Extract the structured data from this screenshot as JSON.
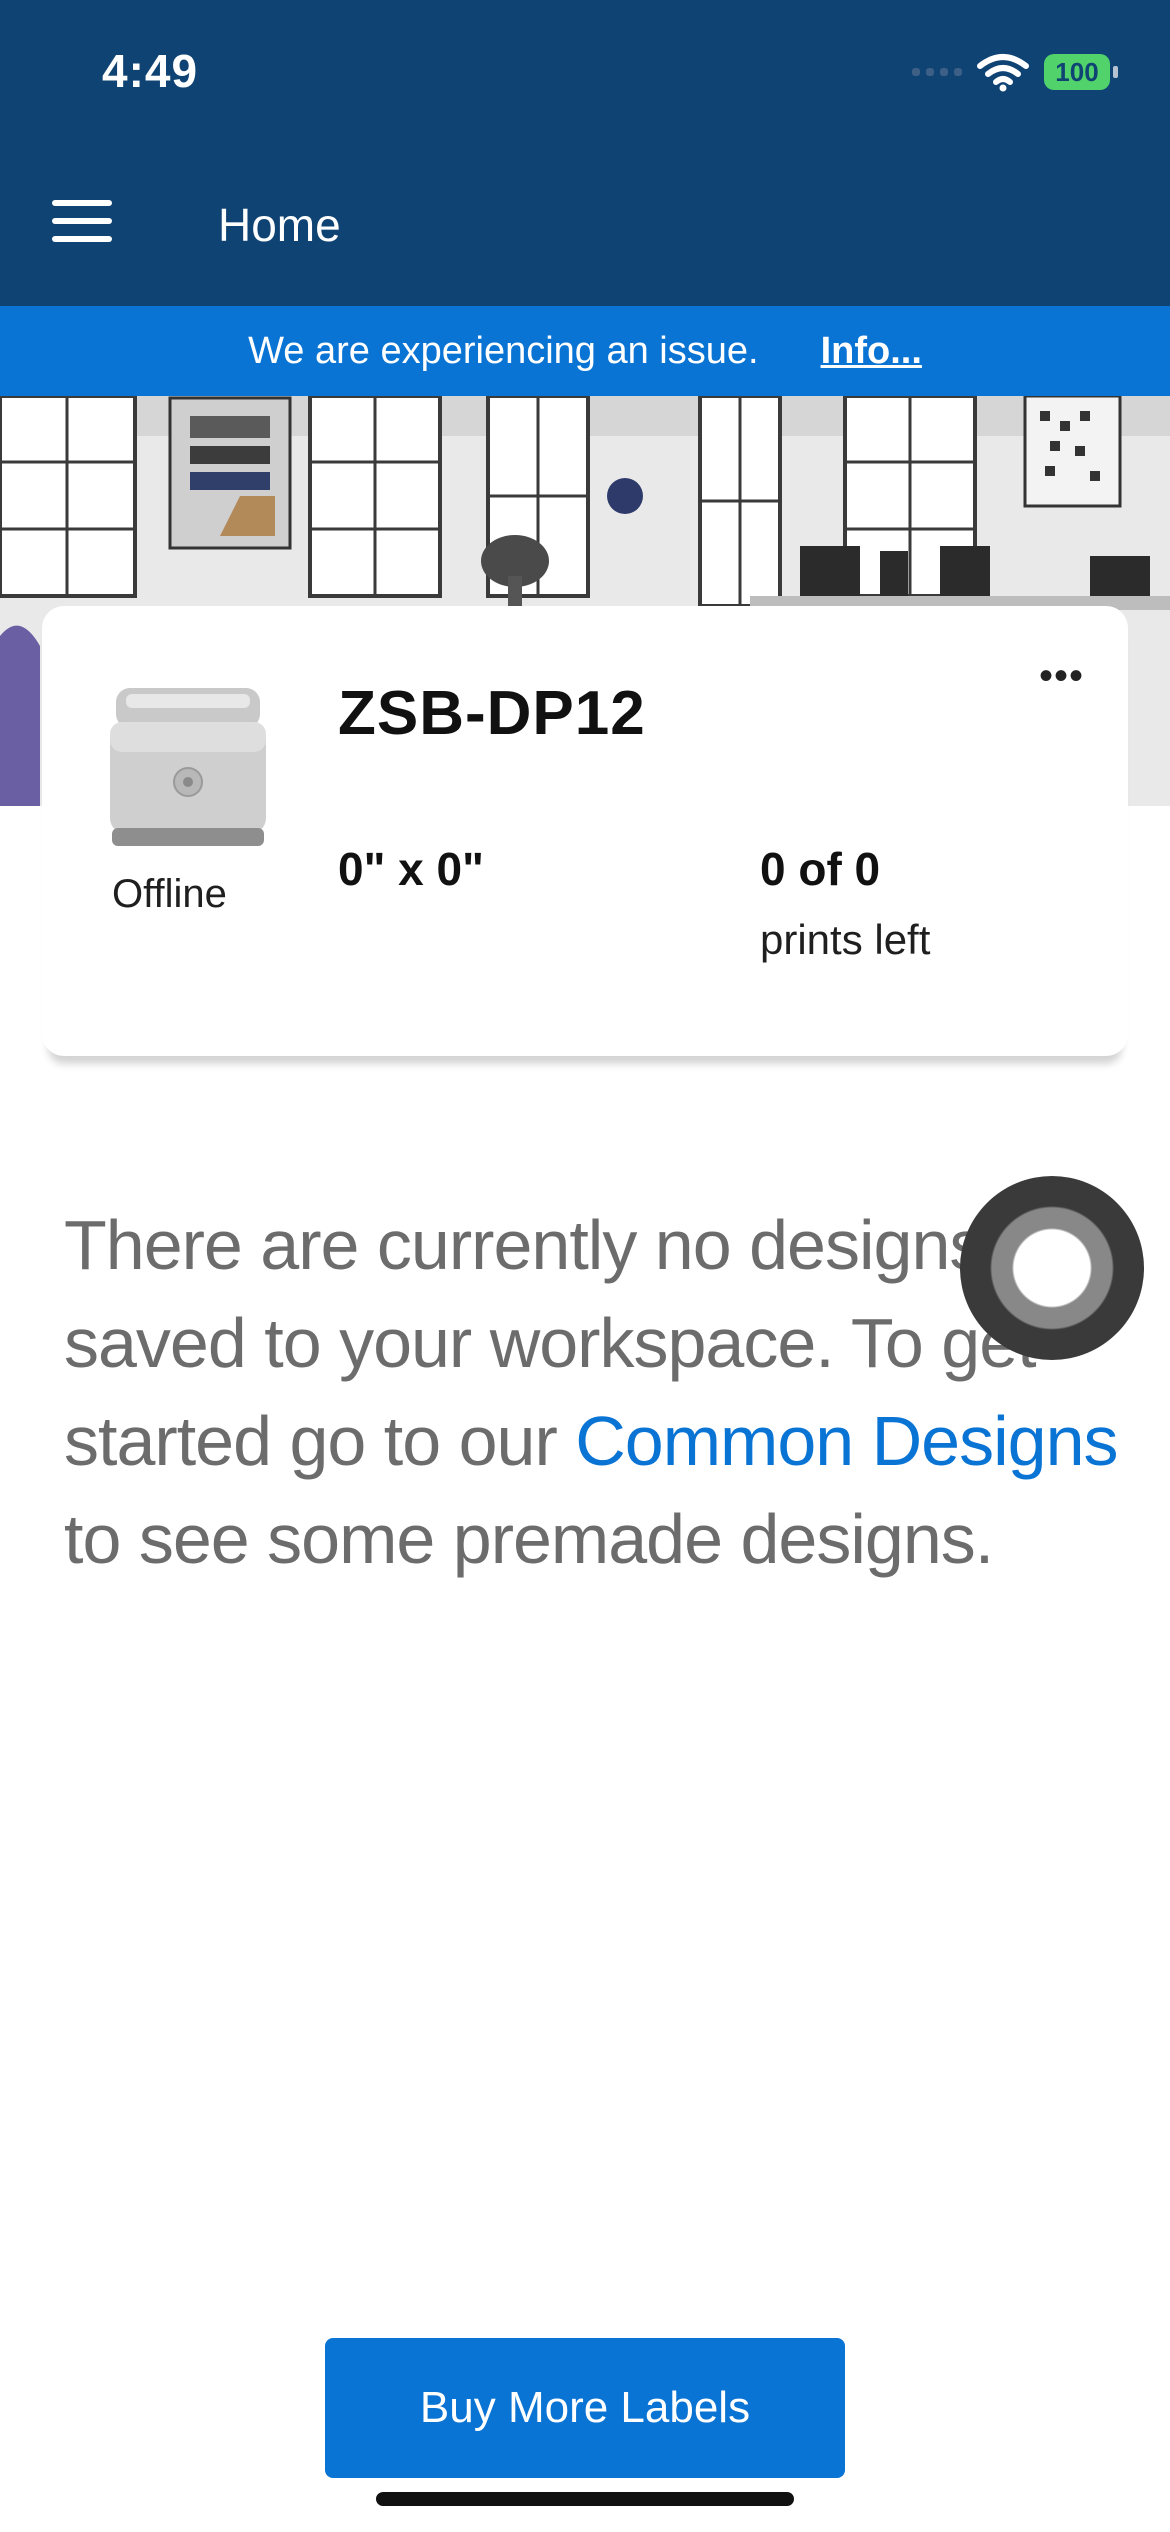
{
  "status_bar": {
    "time": "4:49",
    "battery": "100"
  },
  "header": {
    "title": "Home"
  },
  "banner": {
    "message": "We are experiencing an issue.",
    "link": "Info..."
  },
  "printer": {
    "name": "ZSB-DP12",
    "status": "Offline",
    "label_size": "0\" x 0\"",
    "prints_count": "0 of 0",
    "prints_unit": "prints left",
    "more_label": "•••"
  },
  "empty_state": {
    "text_1": "There are currently no designs saved to your workspace. To get started go to our ",
    "link": "Common Designs",
    "text_2": " to see some premade designs."
  },
  "footer": {
    "buy_label": "Buy More Labels"
  },
  "colors": {
    "header": "#0f4373",
    "banner": "#0a74d4",
    "accent": "#0a74d4",
    "battery": "#52d26b"
  }
}
